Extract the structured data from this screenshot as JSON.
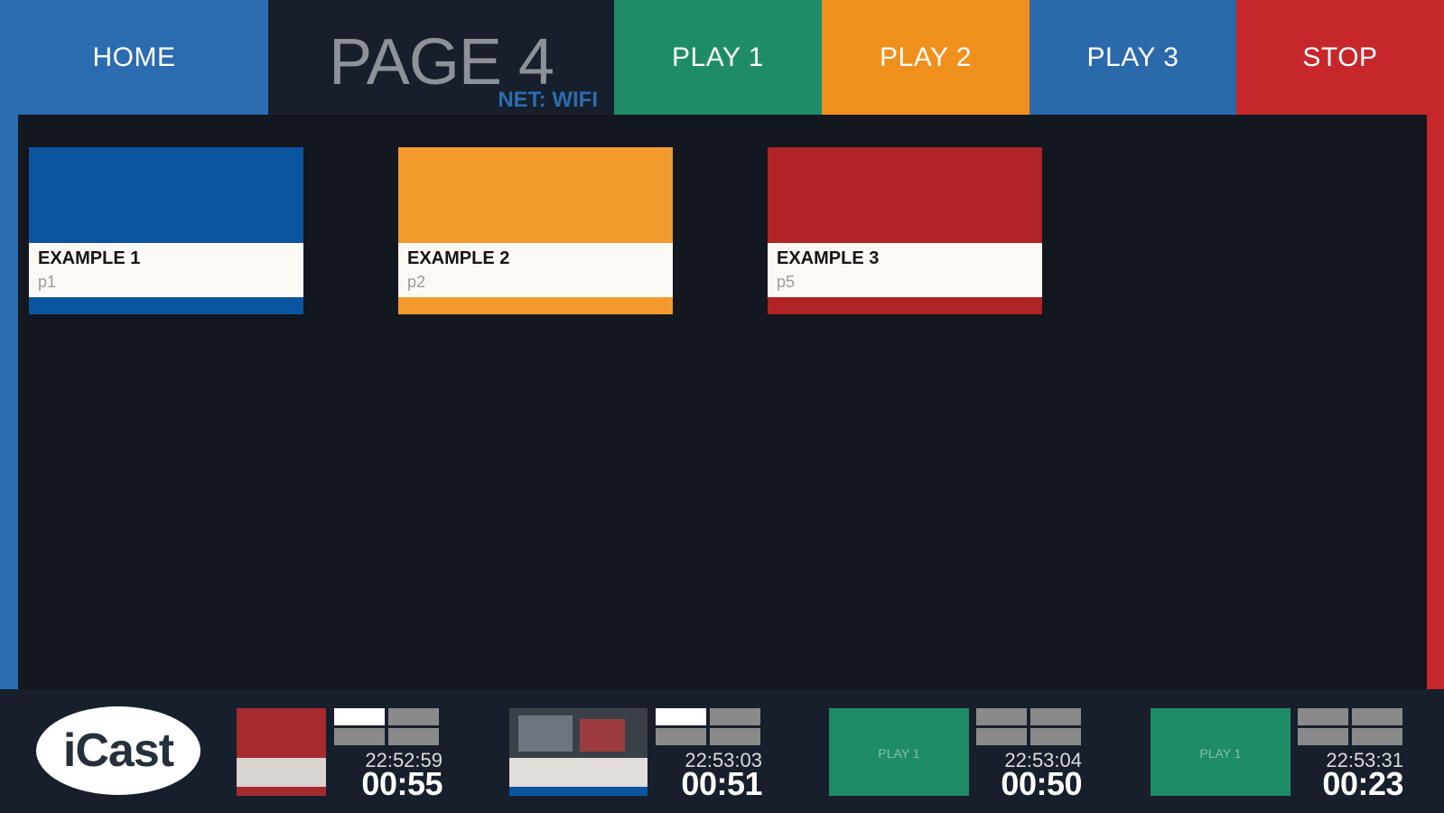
{
  "header": {
    "home_label": "HOME",
    "page_title": "PAGE 4",
    "net_label": "NET: WIFI",
    "play1_label": "PLAY 1",
    "play2_label": "PLAY 2",
    "play3_label": "PLAY 3",
    "stop_label": "STOP"
  },
  "tiles": [
    {
      "title": "EXAMPLE 1",
      "sub": "p1",
      "color": "#0b55a0"
    },
    {
      "title": "EXAMPLE 2",
      "sub": "p2",
      "color": "#f29a2b"
    },
    {
      "title": "EXAMPLE 3",
      "sub": "p5",
      "color": "#b02327"
    }
  ],
  "footer": {
    "logo_text": "iCast",
    "slots": [
      {
        "clock": "22:52:59",
        "timer": "00:55",
        "thumb": "red-tile"
      },
      {
        "clock": "22:53:03",
        "timer": "00:51",
        "thumb": "video-frame"
      },
      {
        "clock": "22:53:04",
        "timer": "00:50",
        "thumb": "play-green",
        "thumb_label": "PLAY 1"
      },
      {
        "clock": "22:53:31",
        "timer": "00:23",
        "thumb": "play-green",
        "thumb_label": "PLAY 1"
      }
    ]
  },
  "colors": {
    "blue": "#2b6cb0",
    "green": "#1f8c68",
    "orange": "#f0901c",
    "red": "#c6272a",
    "dark": "#121720"
  }
}
